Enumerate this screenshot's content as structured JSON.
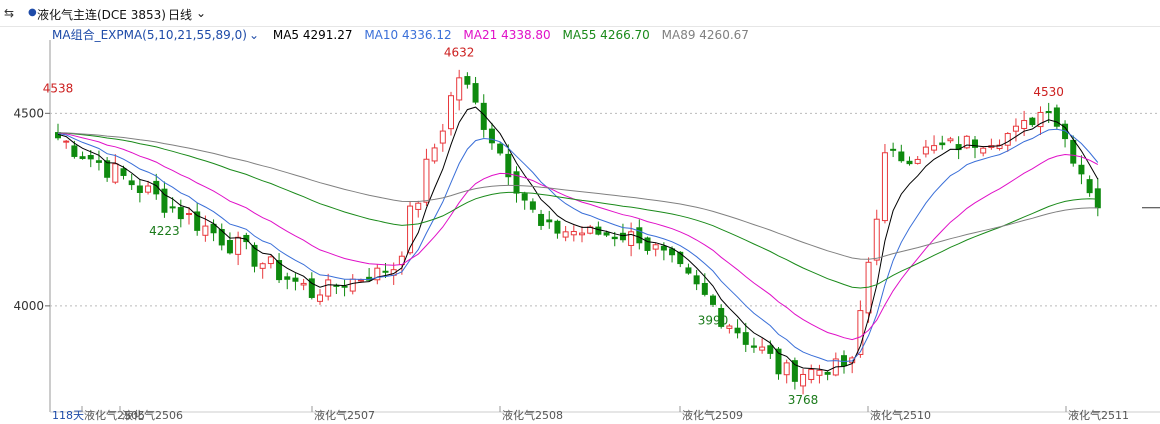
{
  "header": {
    "nav_icon": "double-arrow-icon",
    "instrument": "液化气主连(DCE 3853)",
    "period": "日线"
  },
  "indicator": {
    "name": "MA组合_EXPMA(5,10,21,55,89,0)",
    "items": [
      {
        "label": "MA5 4291.27",
        "color": "#000000"
      },
      {
        "label": "MA10 4336.12",
        "color": "#3a6fd8"
      },
      {
        "label": "MA21 4338.80",
        "color": "#e010c8"
      },
      {
        "label": "MA55 4266.70",
        "color": "#1a8a1a"
      },
      {
        "label": "MA89 4260.67",
        "color": "#808080"
      }
    ]
  },
  "chart_data": {
    "type": "candlestick",
    "y_ticks": [
      4000,
      4500
    ],
    "ylim": [
      3740,
      4680
    ],
    "x_labels": [
      "118天",
      "液化气2505",
      "液化气2506",
      "液化气2507",
      "液化气2508",
      "液化气2509",
      "液化气2510",
      "液化气2511"
    ],
    "annotations": [
      {
        "label": "4530",
        "value": 4530,
        "kind": "high"
      },
      {
        "label": "3990",
        "value": 3990,
        "kind": "low"
      },
      {
        "label": "4632",
        "value": 4632,
        "kind": "high"
      },
      {
        "label": "3768",
        "value": 3768,
        "kind": "low"
      },
      {
        "label": "4538",
        "value": 4538,
        "kind": "high"
      },
      {
        "label": "4223",
        "value": 4223,
        "kind": "low"
      }
    ],
    "colors": {
      "up": "#e8393d",
      "down": "#0f8a0f",
      "grid": "#bbbbbb"
    },
    "segments": [
      {
        "n": 32,
        "end": 4035,
        "amp": 30
      },
      {
        "n": 10,
        "end": 4100,
        "amp": 20
      },
      {
        "n": 8,
        "end": 4600,
        "amp": 40
      },
      {
        "n": 10,
        "end": 4200,
        "amp": 30
      },
      {
        "n": 12,
        "end": 4180,
        "amp": 22
      },
      {
        "n": 18,
        "end": 3820,
        "amp": 35
      },
      {
        "n": 8,
        "end": 3850,
        "amp": 20
      },
      {
        "n": 4,
        "end": 4380,
        "amp": 30
      },
      {
        "n": 16,
        "end": 4450,
        "amp": 25
      },
      {
        "n": 4,
        "end": 4520,
        "amp": 20
      },
      {
        "n": 6,
        "end": 4265,
        "amp": 25
      }
    ],
    "start_close": 4450,
    "ma_periods": [
      5,
      10,
      21,
      55,
      89
    ]
  }
}
